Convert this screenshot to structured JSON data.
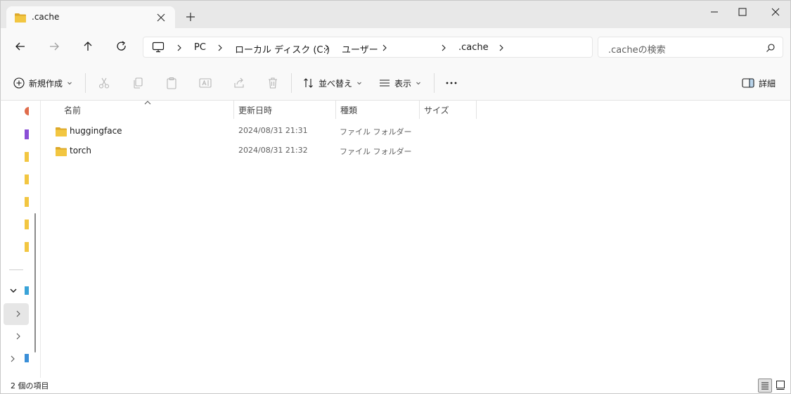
{
  "window": {
    "tab_title": ".cache"
  },
  "address": {
    "breadcrumbs": [
      "PC",
      "ローカル ディスク (C:)",
      "ユーザー",
      "",
      ".cache"
    ]
  },
  "search": {
    "placeholder": ".cacheの検索"
  },
  "toolbar": {
    "new_label": "新規作成",
    "sort_label": "並べ替え",
    "view_label": "表示",
    "details_label": "詳細"
  },
  "columns": {
    "name": "名前",
    "date": "更新日時",
    "type": "種類",
    "size": "サイズ"
  },
  "files": [
    {
      "name": "huggingface",
      "date": "2024/08/31 21:31",
      "type": "ファイル フォルダー",
      "size": ""
    },
    {
      "name": "torch",
      "date": "2024/08/31 21:32",
      "type": "ファイル フォルダー",
      "size": ""
    }
  ],
  "status": {
    "item_count": "2 個の項目"
  },
  "colors": {
    "folder": "#F2C641",
    "folder_dark": "#DDA92B",
    "accent": "#0067C0"
  }
}
